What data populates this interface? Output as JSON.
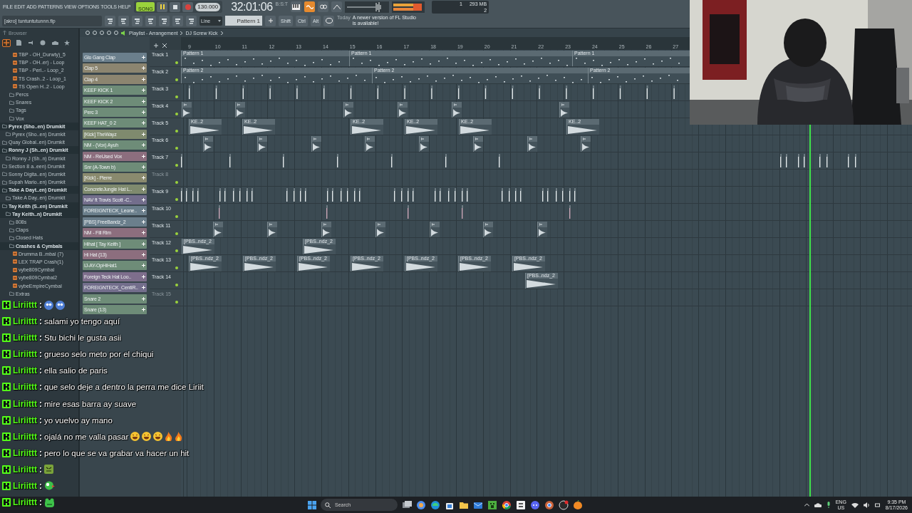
{
  "menu": [
    "FILE",
    "EDIT",
    "ADD",
    "PATTERNS",
    "VIEW",
    "OPTIONS",
    "TOOLS",
    "HELP"
  ],
  "transport": {
    "mode": "SONG",
    "song_mode": true,
    "playing": true,
    "tempo": "130.000",
    "time": "32:01:06",
    "time_unit": "B:S:T"
  },
  "meter": {
    "cpu": "1",
    "memory": "293 MB",
    "polyphony": "2"
  },
  "project": {
    "file": "[akro] tuntuntutunnn.flp"
  },
  "toolbar": {
    "snap": "Line",
    "pattern": "Pattern 1",
    "keys": [
      "Shift",
      "Ctrl",
      "Alt"
    ],
    "hint_day": "Today",
    "hint": "A newer version of FL Studio is available!"
  },
  "browser": {
    "title": "Browser",
    "tabs": [
      {
        "kind": "all",
        "selected": true
      },
      {
        "kind": "file",
        "selected": false
      },
      {
        "kind": "plugin",
        "selected": false
      },
      {
        "kind": "globe",
        "selected": false
      },
      {
        "kind": "cloud",
        "selected": false
      },
      {
        "kind": "star",
        "selected": false
      }
    ],
    "tree": [
      {
        "children": [
          {
            "children": [
              {
                "children": [
                  {
                    "kind": "file",
                    "label": "TBP - OH_Durwty)_5"
                  },
                  {
                    "kind": "file",
                    "label": "TBP - OH..er) - Loop"
                  },
                  {
                    "kind": "file",
                    "label": "TBP - Perl..- Loop_2"
                  },
                  {
                    "kind": "file",
                    "label": "TS Crash..2 - Loop_1"
                  },
                  {
                    "kind": "file",
                    "label": "TS Open H..2 - Loop"
                  }
                ]
              },
              {
                "kind": "folder",
                "label": "Percs",
                "expanded": false
              },
              {
                "kind": "folder",
                "label": "Snares",
                "expanded": false
              },
              {
                "kind": "folder",
                "label": "Tags",
                "expanded": false
              },
              {
                "kind": "folder",
                "label": "Vox",
                "expanded": false
              }
            ]
          }
        ]
      },
      {
        "kind": "folder",
        "label": "Pyrex (Sho..en) Drumkit",
        "expanded": true,
        "children": [
          {
            "kind": "folder",
            "label": "Pyrex (Sho..en) Drumkit",
            "expanded": false
          }
        ]
      },
      {
        "kind": "folder",
        "label": "Quay Global..en) Drumkit",
        "expanded": false
      },
      {
        "kind": "folder",
        "label": "Ronny J (Sh..en) Drumkit",
        "expanded": true,
        "children": [
          {
            "kind": "folder",
            "label": "Ronny J (Sh..n) Drumkit",
            "expanded": false
          }
        ]
      },
      {
        "kind": "folder",
        "label": "Section 8 a..een) Drumkit",
        "expanded": false
      },
      {
        "kind": "folder",
        "label": "Sonny Digita..en) Drumkit",
        "expanded": false
      },
      {
        "kind": "folder",
        "label": "Supah Mario..en) Drumkit",
        "expanded": false
      },
      {
        "kind": "folder",
        "label": "Take A Dayt..en) Drumkit",
        "expanded": true,
        "children": [
          {
            "kind": "folder",
            "label": "Take A Day..en) Drumkit",
            "expanded": false
          }
        ]
      },
      {
        "kind": "folder",
        "label": "Tay Keith (S..en) Drumkit",
        "expanded": true,
        "children": [
          {
            "kind": "folder",
            "label": "Tay Keith..n) Drumkit",
            "expanded": true,
            "children": [
              {
                "kind": "folder",
                "label": "808s",
                "expanded": false
              },
              {
                "kind": "folder",
                "label": "Claps",
                "expanded": false
              },
              {
                "kind": "folder",
                "label": "Closed Hats",
                "expanded": false
              },
              {
                "kind": "folder",
                "label": "Crashes & Cymbals",
                "expanded": true,
                "children": [
                  {
                    "kind": "file",
                    "label": "Drumma B..mbal (7)"
                  },
                  {
                    "kind": "file",
                    "label": "LEX TRAP Crash(1)"
                  },
                  {
                    "kind": "file",
                    "label": "vybe809Cymbal"
                  },
                  {
                    "kind": "file",
                    "label": "vybe809Cymbal2"
                  },
                  {
                    "kind": "file",
                    "label": "vybeEmpireCymbal"
                  }
                ]
              },
              {
                "kind": "folder",
                "label": "Extras",
                "expanded": false
              }
            ]
          }
        ]
      }
    ]
  },
  "playlist": {
    "title": "Playlist - Arrangement",
    "path": "DJ Screw Kick",
    "ruler": [
      "9",
      "10",
      "11",
      "12",
      "13",
      "14",
      "15",
      "16",
      "17",
      "18",
      "19",
      "20",
      "21",
      "22",
      "23",
      "24",
      "25",
      "26",
      "27"
    ],
    "channels": [
      {
        "name": "Glo Gang Clap",
        "color": "#6b7f8c"
      },
      {
        "name": "Clap 5",
        "color": "#8c8570"
      },
      {
        "name": "Clap 4",
        "color": "#8c8570"
      },
      {
        "name": "KEEF KICK 1",
        "color": "#6e8c78"
      },
      {
        "name": "KEEF KICK 2",
        "color": "#6e8c78"
      },
      {
        "name": "Perc 3",
        "color": "#6e8c78"
      },
      {
        "name": "KEEF HAT_0 2",
        "color": "#6e8c78"
      },
      {
        "name": "[Kick] TheWayz",
        "color": "#7f8a6e"
      },
      {
        "name": "NM - (Vox) Ayuh",
        "color": "#6e8c78"
      },
      {
        "name": "NM - ReUsed Vox",
        "color": "#8c6e7e"
      },
      {
        "name": "Snr (A-Town b)",
        "color": "#6e8c78"
      },
      {
        "name": "[Kick] - Pierre",
        "color": "#8a8a6e"
      },
      {
        "name": "ConcreteJungle Hat L..",
        "color": "#7f8a6e"
      },
      {
        "name": "NAV ft Travis Scott -C..",
        "color": "#736e8c"
      },
      {
        "name": "FOREIGNTECK_Leone..",
        "color": "#6b7f8c"
      },
      {
        "name": "[PBS] FreeBandz_2",
        "color": "#6b7f8c"
      },
      {
        "name": "NM - Fill Rim",
        "color": "#8c6e7e"
      },
      {
        "name": "Hihat [ Tay Keith ]",
        "color": "#6e8c78"
      },
      {
        "name": "Hi Hat (13)",
        "color": "#8c6e7e"
      },
      {
        "name": "IJ-AY-OpHiHat1",
        "color": "#6e8c78"
      },
      {
        "name": "Foreign Teck Hat Loo..",
        "color": "#7e6e8c"
      },
      {
        "name": "FOREIGNTECK_CentiR..",
        "color": "#736e8c"
      },
      {
        "name": "Snare 2",
        "color": "#6e8c78"
      },
      {
        "name": "Snare (13)",
        "color": "#6e8c78"
      }
    ],
    "tracks": [
      {
        "name": "Track 1",
        "active": true,
        "kind": "clips",
        "clips": [
          {
            "kind": "pattern",
            "label": "Pattern 1"
          },
          {
            "kind": "pattern",
            "label": "Pattern 1"
          },
          {
            "kind": "pattern",
            "label": "Pattern 1"
          }
        ]
      },
      {
        "name": "Track 2",
        "active": true,
        "kind": "clips",
        "clips": [
          {
            "kind": "pattern",
            "label": "Pattern 2"
          },
          {
            "kind": "pattern",
            "label": "Pattern 2"
          },
          {
            "kind": "pattern",
            "label": "Pattern 2"
          }
        ]
      },
      {
        "name": "Track 3",
        "active": true,
        "kind": "hits"
      },
      {
        "name": "Track 4",
        "active": true,
        "kind": "clips",
        "clips": [
          {
            "kind": "oneshot"
          },
          {
            "kind": "oneshot"
          },
          {
            "kind": "oneshot"
          },
          {
            "kind": "oneshot"
          },
          {
            "kind": "oneshot"
          },
          {
            "kind": "oneshot"
          }
        ]
      },
      {
        "name": "Track 5",
        "active": true,
        "kind": "clips",
        "clips": [
          {
            "kind": "sample",
            "label": "KE..2"
          },
          {
            "kind": "sample",
            "label": "KE..2"
          },
          {
            "kind": "sample",
            "label": "KE..2"
          },
          {
            "kind": "sample",
            "label": "KE..2"
          },
          {
            "kind": "sample",
            "label": "KE..2"
          },
          {
            "kind": "sample",
            "label": "KE..2"
          }
        ]
      },
      {
        "name": "Track 6",
        "active": true,
        "kind": "clips",
        "clips": [
          {
            "kind": "oneshot"
          },
          {
            "kind": "oneshot"
          },
          {
            "kind": "oneshot"
          },
          {
            "kind": "oneshot"
          },
          {
            "kind": "oneshot"
          },
          {
            "kind": "oneshot"
          },
          {
            "kind": "oneshot"
          },
          {
            "kind": "oneshot"
          }
        ]
      },
      {
        "name": "Track 7",
        "active": true,
        "kind": "hits"
      },
      {
        "name": "Track 8",
        "active": false,
        "kind": "empty"
      },
      {
        "name": "Track 9",
        "active": true,
        "kind": "hits"
      },
      {
        "name": "Track 10",
        "active": true,
        "kind": "hits"
      },
      {
        "name": "Track 11",
        "active": true,
        "kind": "clips",
        "clips": [
          {
            "kind": "oneshot"
          },
          {
            "kind": "oneshot"
          },
          {
            "kind": "oneshot"
          },
          {
            "kind": "oneshot"
          },
          {
            "kind": "oneshot"
          },
          {
            "kind": "oneshot"
          },
          {
            "kind": "oneshot"
          }
        ]
      },
      {
        "name": "Track 12",
        "active": true,
        "kind": "clips",
        "clips": [
          {
            "kind": "sample",
            "label": "[PBS..ndz_2"
          },
          {
            "kind": "sample",
            "label": "[PBS..ndz_2"
          }
        ]
      },
      {
        "name": "Track 13",
        "active": true,
        "kind": "clips",
        "clips": [
          {
            "kind": "sample",
            "label": "[PBS..ndz_2"
          },
          {
            "kind": "sample",
            "label": "[PBS..ndz_2"
          },
          {
            "kind": "sample",
            "label": "[PBS..ndz_2"
          },
          {
            "kind": "sample",
            "label": "[PBS..ndz_2"
          },
          {
            "kind": "sample",
            "label": "[PBS..ndz_2"
          },
          {
            "kind": "sample",
            "label": "[PBS..ndz_2"
          },
          {
            "kind": "sample",
            "label": "[PBS..ndz_2"
          }
        ]
      },
      {
        "name": "Track 14",
        "active": true,
        "kind": "clips",
        "clips": [
          {
            "kind": "sample",
            "label": "[PBS..ndz_2"
          }
        ]
      },
      {
        "name": "Track 15",
        "active": false,
        "kind": "empty"
      }
    ]
  },
  "chat": [
    {
      "user": "Liriittt",
      "separator": ":",
      "emotes": [
        {
          "kind": "blob"
        },
        {
          "kind": "blob"
        }
      ]
    },
    {
      "user": "Liriittt",
      "separator": ":",
      "message": "salami yo tengo aquí"
    },
    {
      "user": "Liriittt",
      "separator": ":",
      "message": "Stu bichi le gusta asii"
    },
    {
      "user": "Liriittt",
      "separator": ":",
      "message": "grueso selo meto por el chiqui"
    },
    {
      "user": "Liriittt",
      "separator": ":",
      "message": "ella salio de paris"
    },
    {
      "user": "Liriittt",
      "separator": ":",
      "message": "que selo deje a dentro la perra me dice Liriit"
    },
    {
      "user": "Liriittt",
      "separator": ":",
      "message": "mire esas barra ay suave"
    },
    {
      "user": "Liriittt",
      "separator": ":",
      "message": "yo vuelvo ay mano"
    },
    {
      "user": "Liriittt",
      "separator": ":",
      "message": "ojalá no me valla pasar",
      "emotes": [
        {
          "kind": "laugh"
        },
        {
          "kind": "laugh"
        },
        {
          "kind": "laugh"
        },
        {
          "kind": "fire"
        },
        {
          "kind": "fire"
        }
      ]
    },
    {
      "user": "Liriittt",
      "separator": ":",
      "message": "pero lo que se va grabar va hacer un hit"
    },
    {
      "user": "Liriittt",
      "separator": ":",
      "emotes": [
        {
          "kind": "square"
        }
      ]
    },
    {
      "user": "Liriittt",
      "separator": ":",
      "emotes": [
        {
          "kind": "bird"
        }
      ]
    },
    {
      "user": "Liriittt",
      "separator": ":",
      "emotes": [
        {
          "kind": "frog"
        }
      ]
    }
  ],
  "taskbar": {
    "search": "Search",
    "language": "ENG",
    "region": "US",
    "time": "9:35 PM",
    "date": "8/17/2026"
  }
}
